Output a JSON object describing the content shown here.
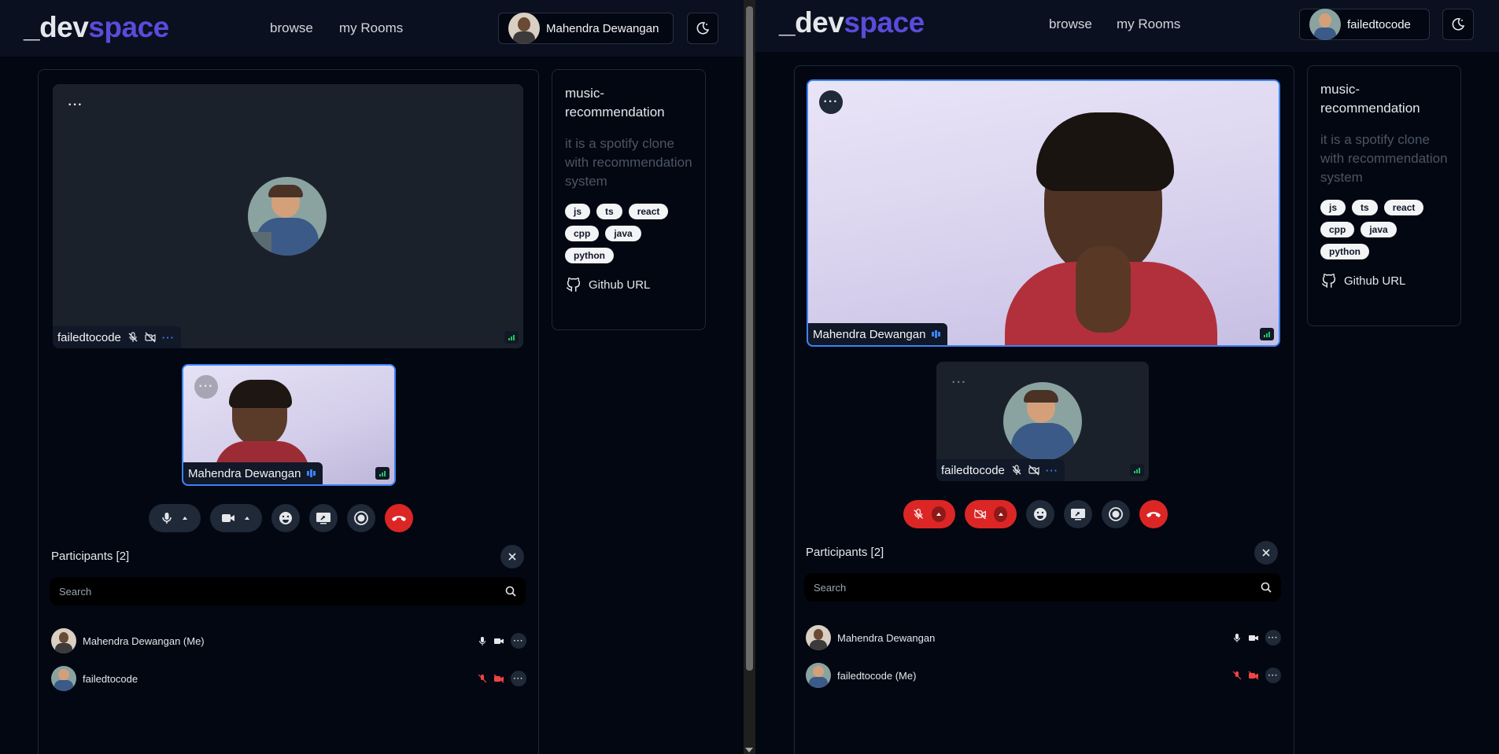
{
  "left": {
    "logo": {
      "prefix": "_dev",
      "suffix": "space"
    },
    "nav": {
      "browse": "browse",
      "rooms": "my Rooms"
    },
    "user": {
      "name": "Mahendra Dewangan"
    },
    "room": {
      "title": "music-recommendation",
      "description": "it is a spotify clone with recommendation system",
      "tags": [
        "js",
        "ts",
        "react",
        "cpp",
        "java",
        "python"
      ],
      "github_label": "Github URL"
    },
    "main_tile": {
      "name": "failedtocode"
    },
    "small_tile": {
      "name": "Mahendra Dewangan"
    },
    "participants": {
      "title": "Participants [2]",
      "search_placeholder": "Search",
      "items": [
        {
          "name": "Mahendra Dewangan (Me)",
          "mic": "on",
          "cam": "on"
        },
        {
          "name": "failedtocode",
          "mic": "off",
          "cam": "off"
        }
      ]
    }
  },
  "right": {
    "logo": {
      "prefix": "_dev",
      "suffix": "space"
    },
    "nav": {
      "browse": "browse",
      "rooms": "my Rooms"
    },
    "user": {
      "name": "failedtocode"
    },
    "room": {
      "title": "music-recommendation",
      "description": "it is a spotify clone with recommendation system",
      "tags": [
        "js",
        "ts",
        "react",
        "cpp",
        "java",
        "python"
      ],
      "github_label": "Github URL"
    },
    "main_tile": {
      "name": "Mahendra Dewangan"
    },
    "small_tile": {
      "name": "failedtocode"
    },
    "participants": {
      "title": "Participants [2]",
      "search_placeholder": "Search",
      "items": [
        {
          "name": "Mahendra Dewangan",
          "mic": "on",
          "cam": "on"
        },
        {
          "name": "failedtocode (Me)",
          "mic": "off",
          "cam": "off"
        }
      ]
    }
  },
  "colors": {
    "accent": "#5b4bdb",
    "active_border": "#3b82f6",
    "danger": "#dc2626",
    "muted_icon": "#ef4444"
  }
}
